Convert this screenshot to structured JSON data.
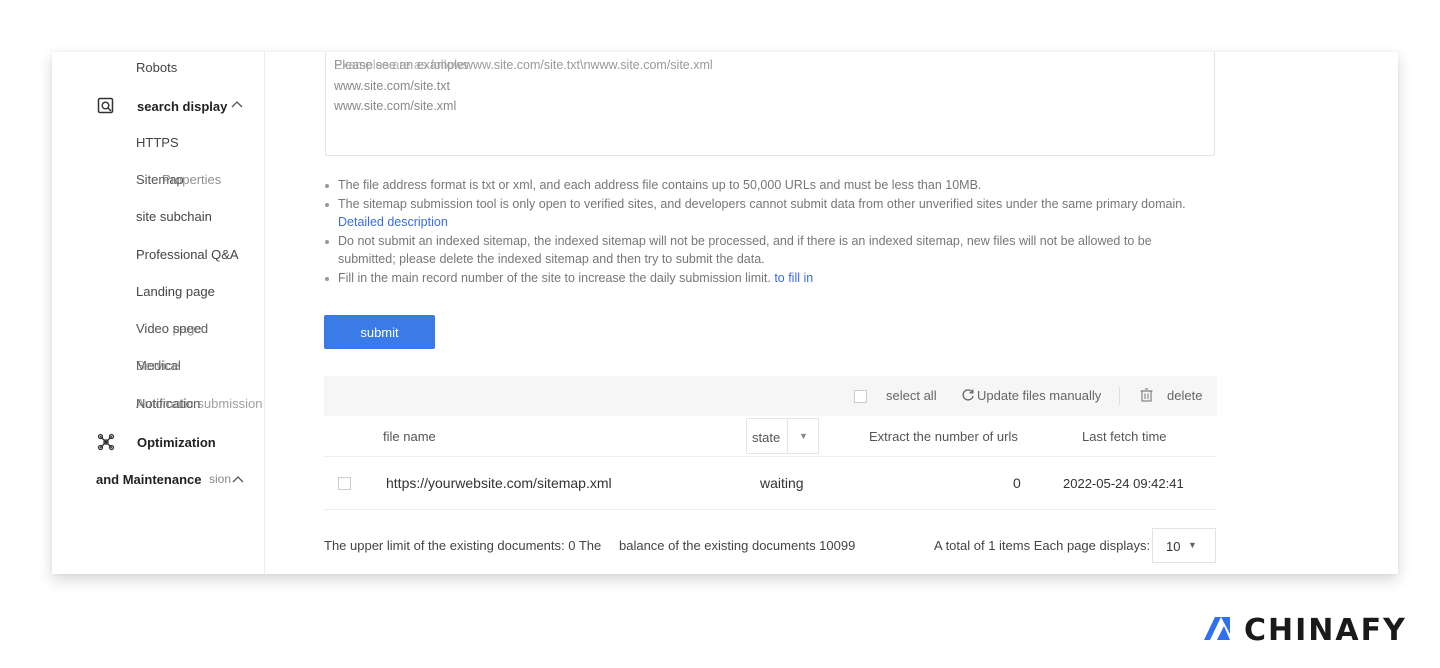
{
  "sidebar": {
    "items_top": [
      "Robots"
    ],
    "group1": {
      "label": "search display",
      "chevron": "^",
      "icon": "search-display-icon"
    },
    "items": [
      "HTTPS",
      "Sitemap",
      "site subchain",
      "Professional Q&A",
      "Landing page",
      "Video speed",
      "Medical",
      "Notification"
    ],
    "overlap_items": {
      "sitemap_overlay": "Site Properties",
      "video_overlay": "Video page",
      "medical_overlay": "Service",
      "notification_overlay": "Automatic submission"
    },
    "group2": {
      "label": "Optimization",
      "label2": "and Maintenance",
      "suffix": "sion",
      "chevron": "^",
      "icon": "optimization-icon"
    }
  },
  "textarea": {
    "placeholder_line1a": "Please see an example:",
    "placeholder_line1b": "Examples are as follows",
    "placeholder_rest": "www.site.com/site.txt\\nwww.site.com/site.xml",
    "lines": [
      "www.site.com/site.txt",
      "www.site.com/site.xml"
    ]
  },
  "notes": {
    "n1": "The file address format is txt or xml, and each address file contains up to 50,000 URLs and must be less than 10MB.",
    "n2": "The sitemap submission tool is only open to verified sites, and developers cannot submit data from other unverified sites under the same primary domain.",
    "n2_link": "Detailed description",
    "n3": "Do not submit an indexed sitemap, the indexed sitemap will not be processed, and if there is an indexed sitemap, new files will not be allowed to be submitted; please delete the indexed sitemap and then try to submit the data.",
    "n4": "Fill in the main record number of the site to increase the daily submission limit.",
    "n4_link": "to fill in"
  },
  "submit_label": "submit",
  "toolbar": {
    "select_all": "select all",
    "update": "Update files manually",
    "delete": "delete"
  },
  "table": {
    "headers": {
      "file_name": "file name",
      "state": "state",
      "urls": "Extract the number of urls",
      "fetch": "Last fetch time"
    },
    "rows": [
      {
        "file": "https://yourwebsite.com/sitemap.xml",
        "state": "waiting",
        "urls": "0",
        "time": "2022-05-24 09:42:41"
      }
    ]
  },
  "footer": {
    "limit_text": "The upper limit of the existing documents: 0 The",
    "balance_text": "balance of the existing documents 10099",
    "total_text": "A total of 1 items Each page displays:",
    "page_size": "10"
  },
  "brand": {
    "name": "CHINAFY",
    "color": "#2f6ff0"
  }
}
